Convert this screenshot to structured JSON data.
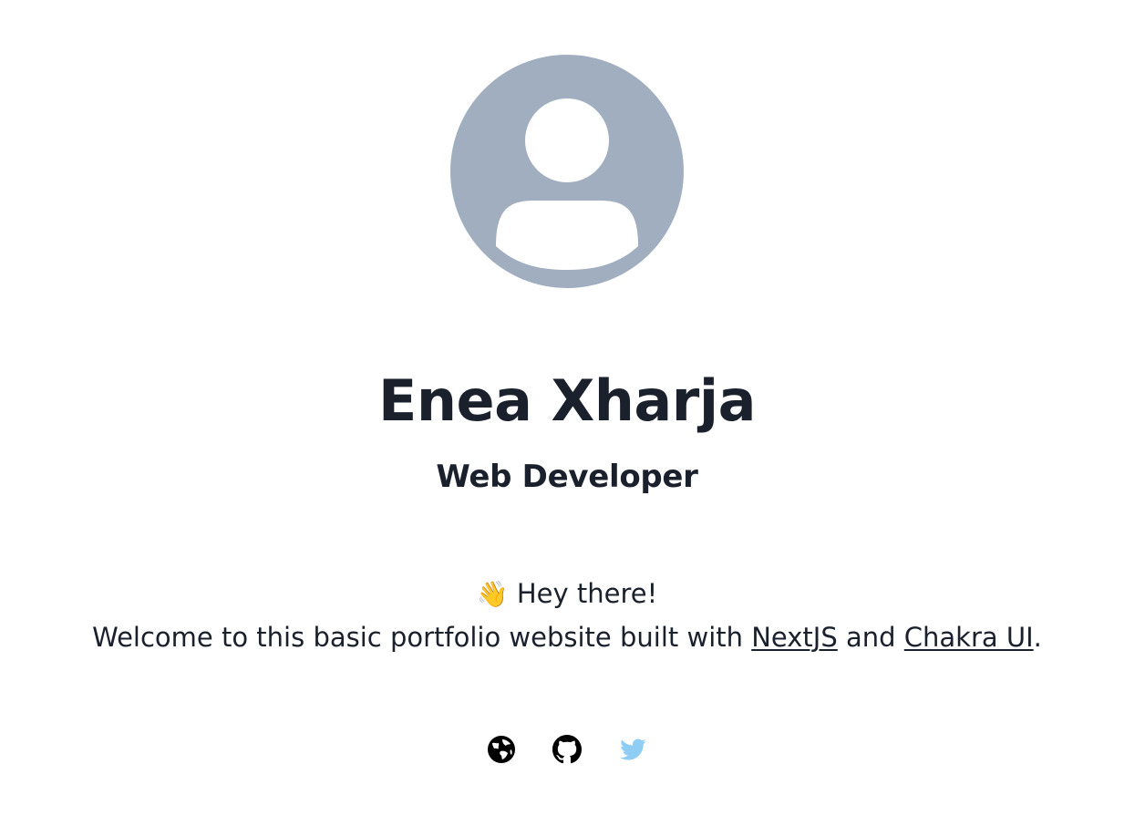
{
  "profile": {
    "name": "Enea Xharja",
    "role": "Web Developer"
  },
  "intro": {
    "wave_emoji": "👋",
    "greeting": "Hey there!",
    "welcome_prefix": "Welcome to this basic portfolio website built with ",
    "link1_label": "NextJS",
    "middle": " and ",
    "link2_label": "Chakra UI",
    "suffix": "."
  },
  "socials": [
    {
      "name": "website",
      "icon": "globe-icon",
      "color": "#000000"
    },
    {
      "name": "github",
      "icon": "github-icon",
      "color": "#000000"
    },
    {
      "name": "twitter",
      "icon": "twitter-icon",
      "color": "#90cdf4"
    }
  ],
  "colors": {
    "avatar_bg": "#a0aec0",
    "text": "#1a202c"
  }
}
